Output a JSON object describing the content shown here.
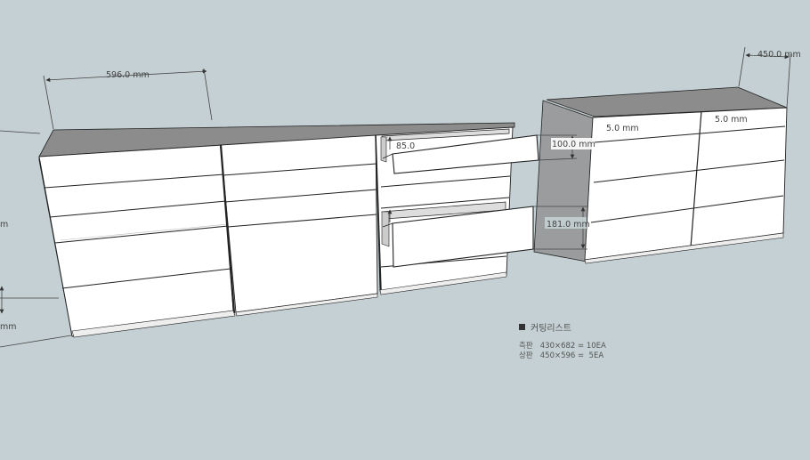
{
  "dimensions": {
    "width_top": "596.0 mm",
    "depth_right": "450.0 mm",
    "drawer_upper": "100.0 mm",
    "drawer_lower": "181.0 mm",
    "inner_partial": "85.0",
    "right_unit_left": "5.0 mm",
    "right_unit_right": "5.0 mm",
    "left_edge_upper": "m",
    "left_edge_lower": "mm"
  },
  "cutting_list": {
    "title": "커팅리스트",
    "rows": [
      {
        "part": "측판",
        "spec": "430×682 = 10EA"
      },
      {
        "part": "상판",
        "spec": "450×596 =  5EA"
      }
    ]
  },
  "colors": {
    "background": "#c4d0d3",
    "top_surface": "#8b8b8b",
    "panel": "#ffffff",
    "shadow_panel": "#9b9c9d"
  }
}
